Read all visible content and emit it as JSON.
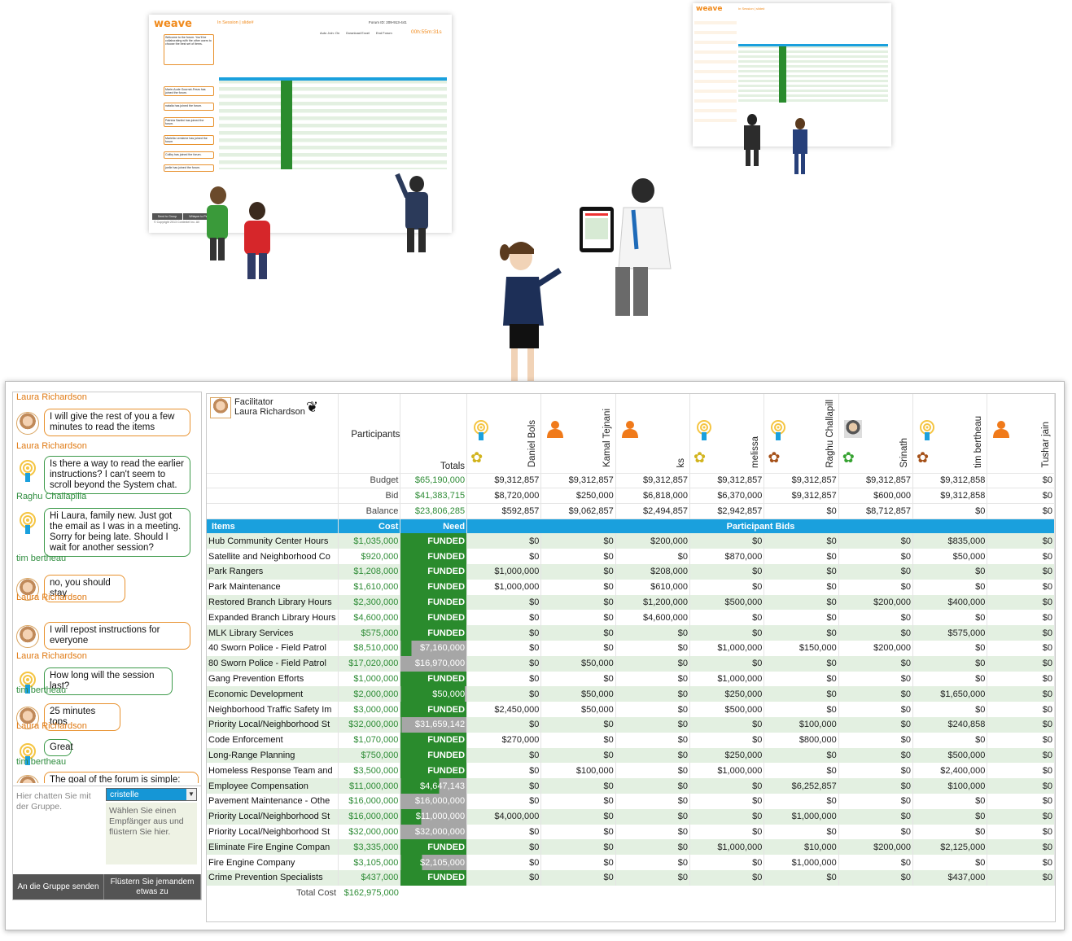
{
  "mini_screen_left": {
    "logo": "weave",
    "session": "In Session | slide#",
    "forum_label": "Forum ID: 209-913-441",
    "buttons": [
      "Auto Join: On",
      "Download Excel",
      "End Forum"
    ],
    "timer": "00h:55m:31s",
    "chat_msgs": [
      "Welcome to the forum. You'll be collaborating with the other users to choose the best set of items.",
      "Marie-Aude Gournot-Fesrs has joined the forum.",
      "natalia has joined the forum.",
      "Patricia Santini has joined the forum.",
      "Mariella Lemieme has joined the forum",
      "Collby has joined the forum.",
      "joelle has joined the forum."
    ],
    "buttons_bottom": [
      "Send to Group",
      "Whisper to Pe"
    ],
    "copyright": "© Copyright 2013 Contextel Inc. All"
  },
  "mini_screen_right": {
    "logo": "weave",
    "session": "In Session | slide#"
  },
  "chat": {
    "top_name": "Laura Richardson",
    "messages": [
      {
        "text": "I will give the rest of you a few minutes to read the items",
        "author": "Laura Richardson",
        "kind": "photo"
      },
      {
        "text": "Is there a way to read the earlier instructions? I can't seem to scroll beyond the System chat.",
        "author": "Raghu Challapilla",
        "kind": "sig"
      },
      {
        "text": "Hi Laura, family new. Just got the email as I was in a meeting. Sorry for being late. Should I wait for another session?",
        "author": "tim bertheau",
        "kind": "sig"
      },
      {
        "text": "no, you should stay",
        "author": "Laura Richardson",
        "kind": "photo"
      },
      {
        "text": "I will repost instructions for everyone",
        "author": "Laura Richardson",
        "kind": "photo"
      },
      {
        "text": "How long will the session last?",
        "author": "tim bertheau",
        "kind": "sig"
      },
      {
        "text": "25 minutes tops",
        "author": "Laura Richardson",
        "kind": "photo"
      },
      {
        "text": "Great",
        "author": "tim bertheau",
        "kind": "sig"
      },
      {
        "text": "The goal of the forum is simple:",
        "author": "",
        "kind": "photo"
      }
    ],
    "input_placeholder": "Hier chatten Sie mit der Gruppe.",
    "recipient": "cristelle",
    "recipient_hint": "Wählen Sie einen Empfänger aus und flüstern Sie hier.",
    "send_group": "An die Gruppe senden",
    "whisper": "Flüstern Sie jemandem etwas zu"
  },
  "grid": {
    "facilitator_label": "Facilitator",
    "facilitator_name": "Laura Richardson",
    "participants_label": "Participants",
    "totals_label": "Totals",
    "participants": [
      {
        "name": "Daniel Bols",
        "icon": "signal",
        "belt": "yellow"
      },
      {
        "name": "Kamal Tejnani",
        "icon": "person",
        "belt": ""
      },
      {
        "name": "ks",
        "icon": "person",
        "belt": ""
      },
      {
        "name": "melissa",
        "icon": "signal",
        "belt": "yellow"
      },
      {
        "name": "Raghu Challapill",
        "icon": "signal",
        "belt": "brown"
      },
      {
        "name": "Srinath",
        "icon": "photo",
        "belt": "green"
      },
      {
        "name": "tim bertheau",
        "icon": "signal",
        "belt": "brown"
      },
      {
        "name": "Tushar jain",
        "icon": "person",
        "belt": ""
      }
    ],
    "summary": [
      {
        "label": "Budget",
        "total": "$65,190,000",
        "values": [
          "$9,312,857",
          "$9,312,857",
          "$9,312,857",
          "$9,312,857",
          "$9,312,857",
          "$9,312,857",
          "$9,312,858",
          "$0"
        ]
      },
      {
        "label": "Bid",
        "total": "$41,383,715",
        "values": [
          "$8,720,000",
          "$250,000",
          "$6,818,000",
          "$6,370,000",
          "$9,312,857",
          "$600,000",
          "$9,312,858",
          "$0"
        ]
      },
      {
        "label": "Balance",
        "total": "$23,806,285",
        "values": [
          "$592,857",
          "$9,062,857",
          "$2,494,857",
          "$2,942,857",
          "$0",
          "$8,712,857",
          "$0",
          "$0"
        ]
      }
    ],
    "col_items": "Items",
    "col_cost": "Cost",
    "col_need": "Need",
    "col_bids": "Participant Bids",
    "rows": [
      {
        "item": "Hub Community Center Hours",
        "cost": "$1,035,000",
        "need": "FUNDED",
        "fill": 1,
        "bids": [
          "$0",
          "$0",
          "$200,000",
          "$0",
          "$0",
          "$0",
          "$835,000",
          "$0"
        ]
      },
      {
        "item": "Satellite and Neighborhood Co",
        "cost": "$920,000",
        "need": "FUNDED",
        "fill": 1,
        "bids": [
          "$0",
          "$0",
          "$0",
          "$870,000",
          "$0",
          "$0",
          "$50,000",
          "$0"
        ]
      },
      {
        "item": "Park Rangers",
        "cost": "$1,208,000",
        "need": "FUNDED",
        "fill": 1,
        "bids": [
          "$1,000,000",
          "$0",
          "$208,000",
          "$0",
          "$0",
          "$0",
          "$0",
          "$0"
        ]
      },
      {
        "item": "Park Maintenance",
        "cost": "$1,610,000",
        "need": "FUNDED",
        "fill": 1,
        "bids": [
          "$1,000,000",
          "$0",
          "$610,000",
          "$0",
          "$0",
          "$0",
          "$0",
          "$0"
        ]
      },
      {
        "item": "Restored Branch Library Hours",
        "cost": "$2,300,000",
        "need": "FUNDED",
        "fill": 1,
        "bids": [
          "$0",
          "$0",
          "$1,200,000",
          "$500,000",
          "$0",
          "$200,000",
          "$400,000",
          "$0"
        ]
      },
      {
        "item": "Expanded Branch Library Hours",
        "cost": "$4,600,000",
        "need": "FUNDED",
        "fill": 1,
        "bids": [
          "$0",
          "$0",
          "$4,600,000",
          "$0",
          "$0",
          "$0",
          "$0",
          "$0"
        ]
      },
      {
        "item": "MLK Library Services",
        "cost": "$575,000",
        "need": "FUNDED",
        "fill": 1,
        "bids": [
          "$0",
          "$0",
          "$0",
          "$0",
          "$0",
          "$0",
          "$575,000",
          "$0"
        ]
      },
      {
        "item": "40 Sworn Police - Field Patrol",
        "cost": "$8,510,000",
        "need": "$7,160,000",
        "fill": 0.16,
        "bids": [
          "$0",
          "$0",
          "$0",
          "$1,000,000",
          "$150,000",
          "$200,000",
          "$0",
          "$0"
        ]
      },
      {
        "item": "80 Sworn Police - Field Patrol",
        "cost": "$17,020,000",
        "need": "$16,970,000",
        "fill": 0.003,
        "bids": [
          "$0",
          "$50,000",
          "$0",
          "$0",
          "$0",
          "$0",
          "$0",
          "$0"
        ]
      },
      {
        "item": "Gang Prevention Efforts",
        "cost": "$1,000,000",
        "need": "FUNDED",
        "fill": 1,
        "bids": [
          "$0",
          "$0",
          "$0",
          "$1,000,000",
          "$0",
          "$0",
          "$0",
          "$0"
        ]
      },
      {
        "item": "Economic Development",
        "cost": "$2,000,000",
        "need": "$50,000",
        "fill": 0.97,
        "bids": [
          "$0",
          "$50,000",
          "$0",
          "$250,000",
          "$0",
          "$0",
          "$1,650,000",
          "$0"
        ]
      },
      {
        "item": "Neighborhood Traffic Safety Im",
        "cost": "$3,000,000",
        "need": "FUNDED",
        "fill": 1,
        "bids": [
          "$2,450,000",
          "$50,000",
          "$0",
          "$500,000",
          "$0",
          "$0",
          "$0",
          "$0"
        ]
      },
      {
        "item": "Priority Local/Neighborhood St",
        "cost": "$32,000,000",
        "need": "$31,659,142",
        "fill": 0.01,
        "bids": [
          "$0",
          "$0",
          "$0",
          "$0",
          "$100,000",
          "$0",
          "$240,858",
          "$0"
        ]
      },
      {
        "item": "Code Enforcement",
        "cost": "$1,070,000",
        "need": "FUNDED",
        "fill": 1,
        "bids": [
          "$270,000",
          "$0",
          "$0",
          "$0",
          "$800,000",
          "$0",
          "$0",
          "$0"
        ]
      },
      {
        "item": "Long-Range Planning",
        "cost": "$750,000",
        "need": "FUNDED",
        "fill": 1,
        "bids": [
          "$0",
          "$0",
          "$0",
          "$250,000",
          "$0",
          "$0",
          "$500,000",
          "$0"
        ]
      },
      {
        "item": "Homeless Response Team and",
        "cost": "$3,500,000",
        "need": "FUNDED",
        "fill": 1,
        "bids": [
          "$0",
          "$100,000",
          "$0",
          "$1,000,000",
          "$0",
          "$0",
          "$2,400,000",
          "$0"
        ]
      },
      {
        "item": "Employee Compensation",
        "cost": "$11,000,000",
        "need": "$4,647,143",
        "fill": 0.58,
        "bids": [
          "$0",
          "$0",
          "$0",
          "$0",
          "$6,252,857",
          "$0",
          "$100,000",
          "$0"
        ]
      },
      {
        "item": "Pavement Maintenance - Othe",
        "cost": "$16,000,000",
        "need": "$16,000,000",
        "fill": 0,
        "bids": [
          "$0",
          "$0",
          "$0",
          "$0",
          "$0",
          "$0",
          "$0",
          "$0"
        ]
      },
      {
        "item": "Priority Local/Neighborhood St",
        "cost": "$16,000,000",
        "need": "$11,000,000",
        "fill": 0.31,
        "bids": [
          "$4,000,000",
          "$0",
          "$0",
          "$0",
          "$1,000,000",
          "$0",
          "$0",
          "$0"
        ]
      },
      {
        "item": "Priority Local/Neighborhood St",
        "cost": "$32,000,000",
        "need": "$32,000,000",
        "fill": 0,
        "bids": [
          "$0",
          "$0",
          "$0",
          "$0",
          "$0",
          "$0",
          "$0",
          "$0"
        ]
      },
      {
        "item": "Eliminate Fire Engine Compan",
        "cost": "$3,335,000",
        "need": "FUNDED",
        "fill": 1,
        "bids": [
          "$0",
          "$0",
          "$0",
          "$1,000,000",
          "$10,000",
          "$200,000",
          "$2,125,000",
          "$0"
        ]
      },
      {
        "item": "Fire Engine Company",
        "cost": "$3,105,000",
        "need": "$2,105,000",
        "fill": 0.32,
        "bids": [
          "$0",
          "$0",
          "$0",
          "$0",
          "$1,000,000",
          "$0",
          "$0",
          "$0"
        ]
      },
      {
        "item": "Crime Prevention Specialists",
        "cost": "$437,000",
        "need": "FUNDED",
        "fill": 1,
        "bids": [
          "$0",
          "$0",
          "$0",
          "$0",
          "$0",
          "$0",
          "$437,000",
          "$0"
        ]
      }
    ],
    "total_cost_label": "Total Cost",
    "total_cost": "$162,975,000"
  },
  "colors": {
    "orange": "#f08a1c",
    "green": "#2a8b2d",
    "blue_header": "#1aa0dd",
    "row_alt": "#e3f0e1"
  }
}
